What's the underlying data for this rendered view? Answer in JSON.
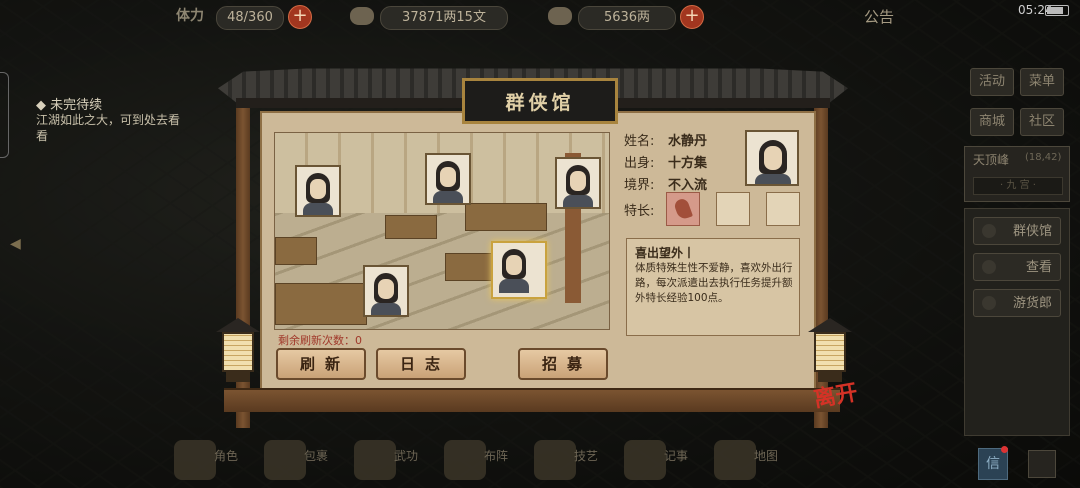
{
  "status_bar": {
    "time": "05:24"
  },
  "top": {
    "stamina_label": "体力",
    "stamina_value": "48/360",
    "money_value": "37871两15文",
    "gold_value": "5636两",
    "plus": "+",
    "notice": "公告"
  },
  "quest": {
    "title": "◆ 未完待续",
    "desc": "江湖如此之大，可到处去看看"
  },
  "right_menu": {
    "activity": "活动",
    "menu": "菜单",
    "shop": "商城",
    "community": "社区",
    "location": "天顶峰",
    "coords": "(18,42)",
    "map_strip": "·  九  宫  ·",
    "items": [
      "群侠馆",
      "查看",
      "游货郎"
    ]
  },
  "bottom_nav": [
    "角色",
    "包裹",
    "武功",
    "布阵",
    "技艺",
    "记事",
    "地图"
  ],
  "mail": "信",
  "dialog": {
    "title": "群侠馆",
    "info": {
      "name_label": "姓名:",
      "name": "水静丹",
      "origin_label": "出身:",
      "origin": "十方集",
      "realm_label": "境界:",
      "realm": "不入流"
    },
    "specialty_label": "特长:",
    "specialty": {
      "title": "喜出望外丨",
      "desc": "体质特殊生性不爱静，喜欢外出行路，每次派遣出去执行任务提升额外特长经验100点。"
    },
    "refresh_label": "剩余刷新次数：0",
    "buttons": {
      "refresh": "刷新",
      "log": "日志",
      "recruit": "招募"
    },
    "leave": "离开"
  },
  "colors": {
    "accent": "#a2361f",
    "panel": "#cdb998",
    "gold_border": "#a8843e",
    "warn": "#a0382a"
  }
}
